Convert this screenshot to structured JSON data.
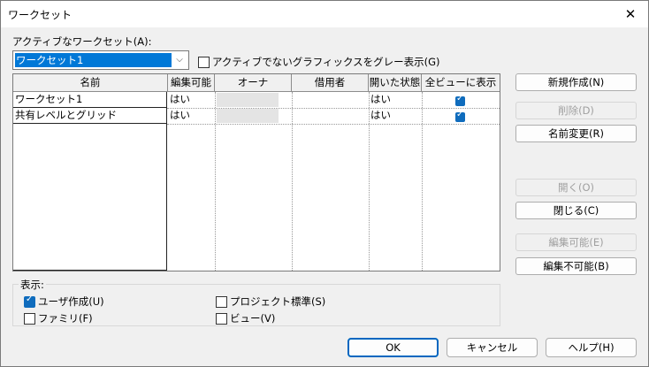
{
  "window": {
    "title": "ワークセット",
    "close_glyph": "✕"
  },
  "active_workset": {
    "label": "アクティブなワークセット(A):",
    "value": "ワークセット1",
    "arrow_glyph": "⌵"
  },
  "gray_graphics": {
    "label": "アクティブでないグラフィックスをグレー表示(G)",
    "checked": false
  },
  "table": {
    "columns": [
      "名前",
      "編集可能",
      "オーナ",
      "借用者",
      "開いた状態",
      "全ビューに表示"
    ],
    "rows": [
      {
        "name": "ワークセット1",
        "editable": "はい",
        "owner": "",
        "borrower": "",
        "open": "はい",
        "visible_all": true
      },
      {
        "name": "共有レベルとグリッド",
        "editable": "はい",
        "owner": "",
        "borrower": "",
        "open": "はい",
        "visible_all": true
      }
    ]
  },
  "side_buttons": {
    "new": "新規作成(N)",
    "delete": "削除(D)",
    "rename": "名前変更(R)",
    "open": "開く(O)",
    "close": "閉じる(C)",
    "editable": "編集可能(E)",
    "not_editable": "編集不可能(B)"
  },
  "show": {
    "label": "表示:",
    "user_created": {
      "label": "ユーザ作成(U)",
      "checked": true
    },
    "families": {
      "label": "ファミリ(F)",
      "checked": false
    },
    "project_standards": {
      "label": "プロジェクト標準(S)",
      "checked": false
    },
    "views": {
      "label": "ビュー(V)",
      "checked": false
    }
  },
  "footer": {
    "ok": "OK",
    "cancel": "キャンセル",
    "help": "ヘルプ(H)"
  }
}
